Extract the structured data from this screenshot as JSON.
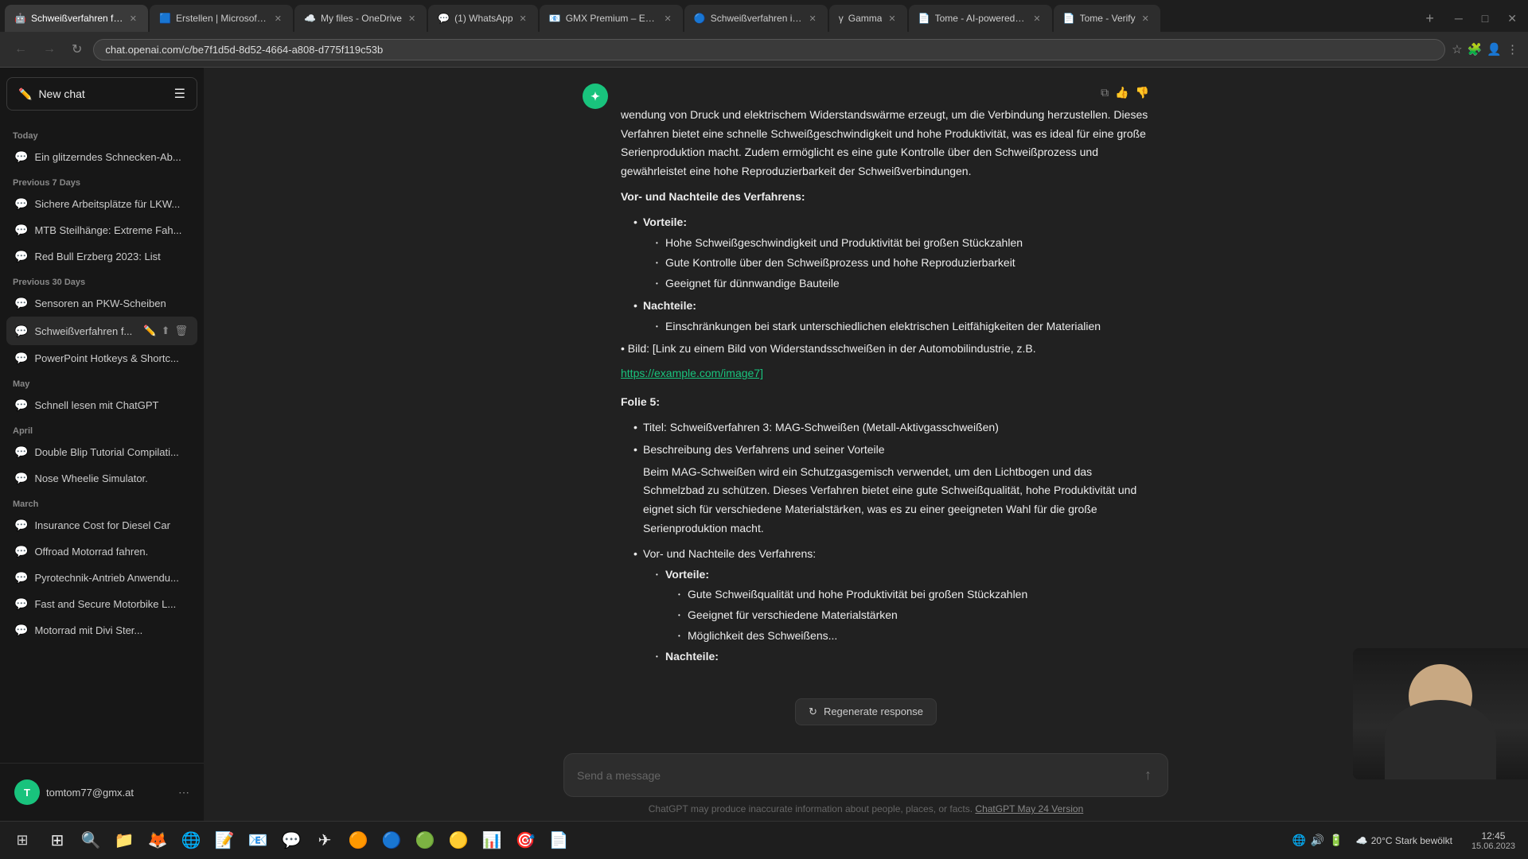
{
  "browser": {
    "tabs": [
      {
        "id": "t1",
        "label": "Schweißverfahren fü...",
        "active": true,
        "favicon": "🤖"
      },
      {
        "id": "t2",
        "label": "Erstellen | Microsoft 3...",
        "active": false,
        "favicon": "🟦"
      },
      {
        "id": "t3",
        "label": "My files - OneDrive",
        "active": false,
        "favicon": "☁️"
      },
      {
        "id": "t4",
        "label": "(1) WhatsApp",
        "active": false,
        "favicon": "💬"
      },
      {
        "id": "t5",
        "label": "GMX Premium – E-M...",
        "active": false,
        "favicon": "📧"
      },
      {
        "id": "t6",
        "label": "Schweißverfahren in...",
        "active": false,
        "favicon": "🔵"
      },
      {
        "id": "t7",
        "label": "Gamma",
        "active": false,
        "favicon": "γ"
      },
      {
        "id": "t8",
        "label": "Tome - AI-powered s...",
        "active": false,
        "favicon": "📄"
      },
      {
        "id": "t9",
        "label": "Tome - Verify",
        "active": false,
        "favicon": "📄"
      }
    ],
    "address": "chat.openai.com/c/be7f1d5d-8d52-4664-a808-d775f119c53b"
  },
  "sidebar": {
    "new_chat_label": "New chat",
    "sections": [
      {
        "label": "Today",
        "items": [
          {
            "text": "Ein glitzerndes Schnecken-Ab..."
          }
        ]
      },
      {
        "label": "Previous 7 Days",
        "items": [
          {
            "text": "Sichere Arbeitsplätze für LKW..."
          },
          {
            "text": "MTB Steilhänge: Extreme Fah..."
          },
          {
            "text": "Red Bull Erzberg 2023: List"
          }
        ]
      },
      {
        "label": "Previous 30 Days",
        "items": [
          {
            "text": "Sensoren an PKW-Scheiben"
          },
          {
            "text": "Schweißverfahren f...",
            "active": true
          },
          {
            "text": "PowerPoint Hotkeys & Shortc..."
          }
        ]
      },
      {
        "label": "May",
        "items": [
          {
            "text": "Schnell lesen mit ChatGPT"
          }
        ]
      },
      {
        "label": "April",
        "items": [
          {
            "text": "Double Blip Tutorial Compilati..."
          },
          {
            "text": "Nose Wheelie Simulator."
          }
        ]
      },
      {
        "label": "March",
        "items": [
          {
            "text": "Insurance Cost for Diesel Car"
          },
          {
            "text": "Offroad Motorrad fahren."
          },
          {
            "text": "Pyrotechnik-Antrieb Anwendu..."
          },
          {
            "text": "Fast and Secure Motorbike L..."
          },
          {
            "text": "Motorrad mit Divi Ster..."
          }
        ]
      }
    ],
    "user": {
      "email": "tomtom77@gmx.at",
      "initials": "T"
    }
  },
  "chat": {
    "message_icon": "✦",
    "content": {
      "intro": "wendung von Druck und elektrischem Widerstandswärme erzeugt, um die Verbindung herzustellen. Dieses Verfahren bietet eine schnelle Schweißgeschwindigkeit und hohe Produktivität, was es ideal für eine große Serienproduktion macht. Zudem ermöglicht es eine gute Kontrolle über den Schweißprozess und gewährleistet eine hohe Reproduzierbarkeit der Schweißverbindungen.",
      "section1_title": "Vor- und Nachteile des Verfahrens:",
      "vorteile_label": "Vorteile:",
      "vorteile_items": [
        "Hohe Schweißgeschwindigkeit und Produktivität bei großen Stückzahlen",
        "Gute Kontrolle über den Schweißprozess und hohe Reproduzierbarkeit",
        "Geeignet für dünnwandige Bauteile"
      ],
      "nachteile_label": "Nachteile:",
      "nachteile_items": [
        "Einschränkungen bei stark unterschiedlichen elektrischen Leitfähigkeiten der Materialien"
      ],
      "bild_label": "Bild:",
      "bild_text": "[Link zu einem Bild von Widerstandsschweißen in der Automobilindustrie, z.B.",
      "bild_link": "https://example.com/image7]",
      "folie5_label": "Folie 5:",
      "folie5_title_label": "Titel:",
      "folie5_title": "Schweißverfahren 3: MAG-Schweißen (Metall-Aktivgasschweißen)",
      "folie5_beschreibung_label": "Beschreibung des Verfahrens und seiner Vorteile",
      "folie5_desc": "Beim MAG-Schweißen wird ein Schutzgasgemisch verwendet, um den Lichtbogen und das Schmelzbad zu schützen. Dieses Verfahren bietet eine gute Schweißqualität, hohe Produktivität und eignet sich für verschiedene Materialstärken, was es zu einer geeigneten Wahl für die große Serienproduktion macht.",
      "folie5_vn_label": "Vor- und Nachteile des Verfahrens:",
      "folie5_vorteile_label": "Vorteile:",
      "folie5_vorteile_items": [
        "Gute Schweißqualität und hohe Produktivität bei großen Stückzahlen",
        "Geeignet für verschiedene Materialstärken",
        "Möglichkeit des Schweißens..."
      ],
      "folie5_nachteile_label": "Nachteile:"
    },
    "regenerate_label": "Regenerate response",
    "input_placeholder": "Send a message",
    "disclaimer": "ChatGPT may produce inaccurate information about people, places, or facts.",
    "disclaimer_link": "ChatGPT May 24 Version"
  },
  "taskbar": {
    "icons": [
      {
        "name": "windows-start",
        "symbol": "⊞"
      },
      {
        "name": "search",
        "symbol": "🔍"
      },
      {
        "name": "file-explorer",
        "symbol": "📁"
      },
      {
        "name": "firefox",
        "symbol": "🦊"
      },
      {
        "name": "chrome",
        "symbol": "🌐"
      },
      {
        "name": "word",
        "symbol": "📝"
      },
      {
        "name": "outlook",
        "symbol": "📧"
      },
      {
        "name": "teams",
        "symbol": "💬"
      },
      {
        "name": "telegram",
        "symbol": "✈"
      },
      {
        "name": "app1",
        "symbol": "🟠"
      },
      {
        "name": "app2",
        "symbol": "🔵"
      },
      {
        "name": "app3",
        "symbol": "🟢"
      },
      {
        "name": "app4",
        "symbol": "🟡"
      },
      {
        "name": "excel",
        "symbol": "📊"
      },
      {
        "name": "app5",
        "symbol": "🎯"
      },
      {
        "name": "word2",
        "symbol": "📄"
      }
    ],
    "systray": {
      "weather": "20°C Stark bewölkt",
      "weather_icon": "☁️",
      "time": "12:45",
      "date": "15.06.2023"
    }
  }
}
